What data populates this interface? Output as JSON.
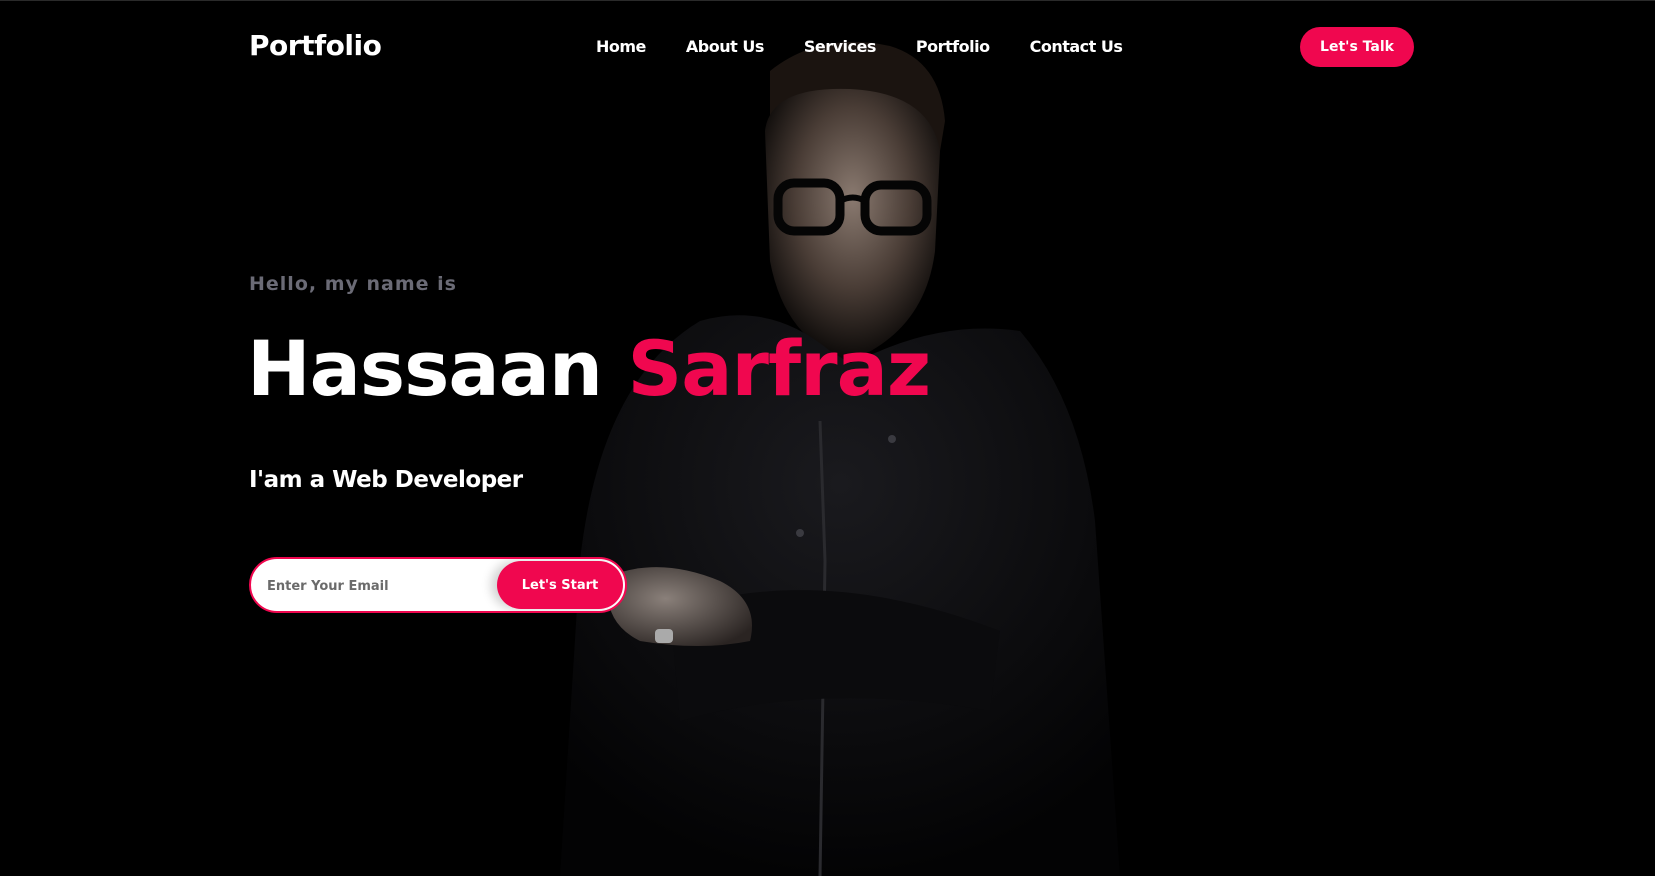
{
  "brand": {
    "logo": "Portfolio"
  },
  "nav": {
    "items": [
      {
        "label": "Home"
      },
      {
        "label": "About Us"
      },
      {
        "label": "Services"
      },
      {
        "label": "Portfolio"
      },
      {
        "label": "Contact Us"
      }
    ],
    "cta_label": "Let's Talk"
  },
  "hero": {
    "greeting": "Hello, my name is",
    "first_name": "Hassaan",
    "last_name": "Sarfraz",
    "role": "I'am a Web Developer",
    "email_placeholder": "Enter Your Email",
    "start_label": "Let's Start"
  },
  "colors": {
    "background": "#000000",
    "accent": "#f0074f",
    "greeting": "#6b6b76",
    "text": "#ffffff"
  }
}
